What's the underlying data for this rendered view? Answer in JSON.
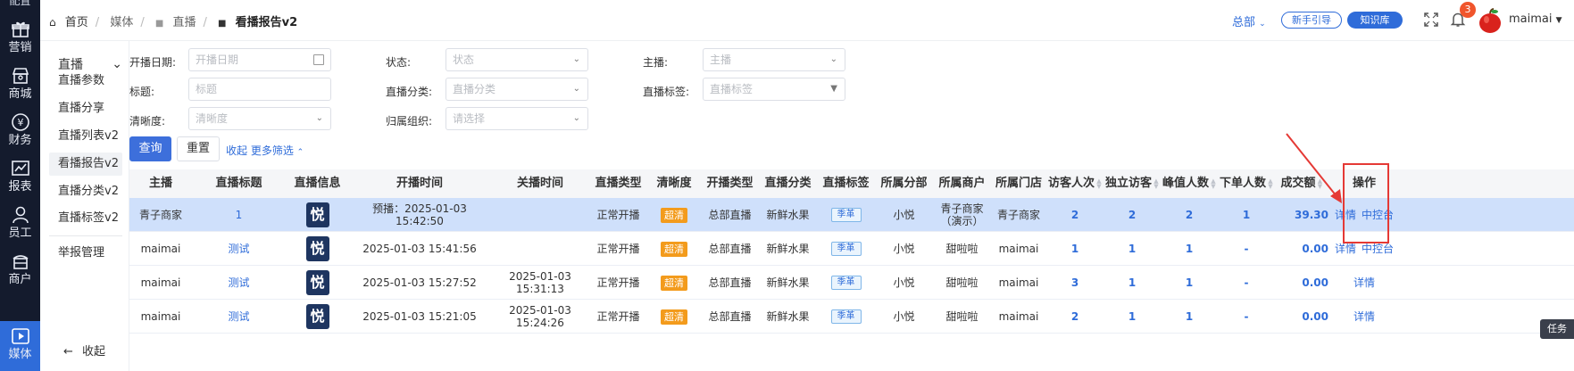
{
  "rail": {
    "top_partial": "配置",
    "items": [
      {
        "label": "营销",
        "icon": "gift-icon"
      },
      {
        "label": "商城",
        "icon": "store-icon"
      },
      {
        "label": "财务",
        "icon": "yuan-icon"
      },
      {
        "label": "报表",
        "icon": "chart-icon"
      },
      {
        "label": "员工",
        "icon": "user-icon"
      },
      {
        "label": "商户",
        "icon": "shop-icon"
      },
      {
        "label": "媒体",
        "icon": "play-icon",
        "active": true
      }
    ]
  },
  "submenu": {
    "group": "直播",
    "items": [
      "直播参数",
      "直播分享",
      "直播列表v2",
      "看播报告v2",
      "直播分类v2",
      "直播标签v2"
    ],
    "active_index": 3,
    "extra": "举报管理",
    "collapse": "收起"
  },
  "header": {
    "breadcrumb": [
      "首页",
      "媒体",
      "直播",
      "看播报告v2"
    ],
    "org": "总部",
    "guide_btn": "新手引导",
    "knowledge_btn": "知识库",
    "notif_count": "3",
    "username": "maimai"
  },
  "filters": {
    "start_date": {
      "label": "开播日期:",
      "placeholder": "开播日期"
    },
    "status": {
      "label": "状态:",
      "placeholder": "状态"
    },
    "anchor": {
      "label": "主播:",
      "placeholder": "主播"
    },
    "title": {
      "label": "标题:",
      "placeholder": "标题"
    },
    "category": {
      "label": "直播分类:",
      "placeholder": "直播分类"
    },
    "tag": {
      "label": "直播标签:",
      "placeholder": "直播标签"
    },
    "definition": {
      "label": "清晰度:",
      "placeholder": "清晰度"
    },
    "org": {
      "label": "归属组织:",
      "placeholder": "请选择"
    },
    "query_btn": "查询",
    "reset_btn": "重置",
    "collapse_link": "收起 更多筛选"
  },
  "table": {
    "columns": [
      "主播",
      "直播标题",
      "直播信息",
      "开播时间",
      "关播时间",
      "直播类型",
      "清晰度",
      "开播类型",
      "直播分类",
      "直播标签",
      "所属分部",
      "所属商户",
      "所属门店",
      "访客人次",
      "独立访客",
      "峰值人数",
      "下单人数",
      "成交额",
      "操作"
    ],
    "rows": [
      {
        "anchor": "青子商家",
        "title": "1",
        "logo": "悦",
        "start": "预播：2025-01-03 15:42:50",
        "end": "",
        "type": "正常开播",
        "def": "超清",
        "open_type": "总部直播",
        "category": "新鲜水果",
        "tag": "季革",
        "branch": "小悦",
        "merchant": "青子商家（演示）",
        "store": "青子商家",
        "visits": "2",
        "uv": "2",
        "peak": "2",
        "orders": "1",
        "amount": "39.30",
        "op1": "详情",
        "op2": "中控台"
      },
      {
        "anchor": "maimai",
        "title": "测试",
        "logo": "悦",
        "start": "2025-01-03 15:41:56",
        "end": "",
        "type": "正常开播",
        "def": "超清",
        "open_type": "总部直播",
        "category": "新鲜水果",
        "tag": "季革",
        "branch": "小悦",
        "merchant": "甜啦啦",
        "store": "maimai",
        "visits": "1",
        "uv": "1",
        "peak": "1",
        "orders": "-",
        "amount": "0.00",
        "op1": "详情",
        "op2": "中控台"
      },
      {
        "anchor": "maimai",
        "title": "测试",
        "logo": "悦",
        "start": "2025-01-03 15:27:52",
        "end": "2025-01-03 15:31:13",
        "type": "正常开播",
        "def": "超清",
        "open_type": "总部直播",
        "category": "新鲜水果",
        "tag": "季革",
        "branch": "小悦",
        "merchant": "甜啦啦",
        "store": "maimai",
        "visits": "3",
        "uv": "1",
        "peak": "1",
        "orders": "-",
        "amount": "0.00",
        "op1": "详情",
        "op2": ""
      },
      {
        "anchor": "maimai",
        "title": "测试",
        "logo": "悦",
        "start": "2025-01-03 15:21:05",
        "end": "2025-01-03 15:24:26",
        "type": "正常开播",
        "def": "超清",
        "open_type": "总部直播",
        "category": "新鲜水果",
        "tag": "季革",
        "branch": "小悦",
        "merchant": "甜啦啦",
        "store": "maimai",
        "visits": "2",
        "uv": "1",
        "peak": "1",
        "orders": "-",
        "amount": "0.00",
        "op1": "详情",
        "op2": ""
      }
    ]
  },
  "task_tab": "任务",
  "colors": {
    "accent": "#2f6cd9",
    "rail_bg": "#141b2d",
    "selected_row": "#cfe0fb",
    "highlight": "#e53935"
  }
}
